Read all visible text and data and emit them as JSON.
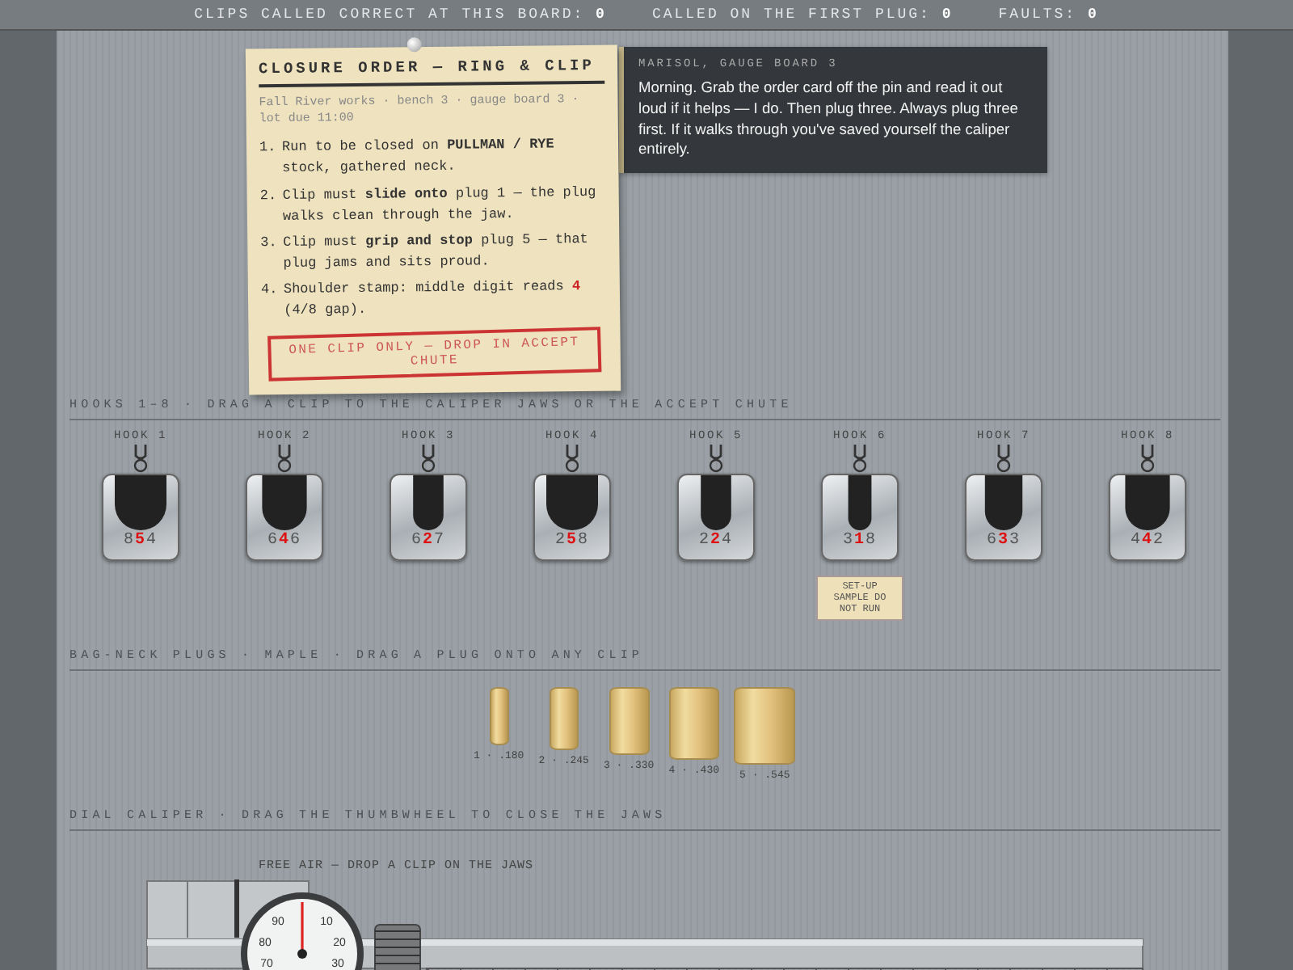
{
  "status_bar": [
    {
      "label": "CLIPS CALLED CORRECT AT THIS BOARD:",
      "value": "0"
    },
    {
      "label": "CALLED ON THE FIRST PLUG:",
      "value": "0"
    },
    {
      "label": "FAULTS:",
      "value": "0"
    }
  ],
  "order_card": {
    "title": "CLOSURE ORDER — RING & CLIP",
    "meta": "Fall River works · bench 3 · gauge board 3 · lot due 11:00",
    "items": [
      {
        "kind": "rule",
        "number": "1.",
        "text": "Run to be closed on **PULLMAN / RYE** stock, gathered neck."
      },
      {
        "kind": "rule",
        "number": "2.",
        "text": "Clip must **slide onto** plug 1 — the plug walks clean through the jaw."
      },
      {
        "kind": "rule",
        "number": "3.",
        "text": "Clip must **grip and stop** plug 5 — that plug jams and sits proud."
      },
      {
        "kind": "stamp",
        "number": "4.",
        "text": "Shoulder stamp: middle digit reads **4** (4/8 gap)."
      }
    ],
    "stamp": "ONE CLIP ONLY — DROP IN ACCEPT CHUTE"
  },
  "speech": {
    "speaker": "MARISOL, GAUGE BOARD 3",
    "text": "Morning. Grab the order card off the pin and read it out loud if it helps — I do. Then plug three. Always plug three first. If it walks through you've saved yourself the caliper entirely."
  },
  "hooks": {
    "header": "HOOKS 1–8 · DRAG A CLIP TO THE CALIPER JAWS OR THE ACCEPT CHUTE",
    "items": [
      {
        "label": "HOOK 1",
        "code": [
          "8",
          "5",
          "4"
        ]
      },
      {
        "label": "HOOK 2",
        "code": [
          "6",
          "4",
          "6"
        ]
      },
      {
        "label": "HOOK 3",
        "code": [
          "6",
          "2",
          "7"
        ]
      },
      {
        "label": "HOOK 4",
        "code": [
          "2",
          "5",
          "8"
        ]
      },
      {
        "label": "HOOK 5",
        "code": [
          "2",
          "2",
          "4"
        ]
      },
      {
        "label": "HOOK 6",
        "code": [
          "3",
          "1",
          "8"
        ],
        "tag": "SET-UP SAMPLE DO NOT RUN"
      },
      {
        "label": "HOOK 7",
        "code": [
          "6",
          "3",
          "3"
        ]
      },
      {
        "label": "HOOK 8",
        "code": [
          "4",
          "4",
          "2"
        ]
      }
    ]
  },
  "plugs": {
    "header": "BAG-NECK PLUGS · MAPLE · DRAG A PLUG ONTO ANY CLIP",
    "items": [
      {
        "label": "1 · .180"
      },
      {
        "label": "2 · .245"
      },
      {
        "label": "3 · .330"
      },
      {
        "label": "4 · .430"
      },
      {
        "label": "5 · .545"
      }
    ]
  },
  "caliper": {
    "header": "DIAL CALIPER · DRAG THE THUMBWHEEL TO CLOSE THE JAWS",
    "status": "FREE AIR — DROP A CLIP ON THE JAWS",
    "dial_labels": [
      "90",
      "10",
      "80",
      "20",
      "70",
      "30"
    ]
  }
}
